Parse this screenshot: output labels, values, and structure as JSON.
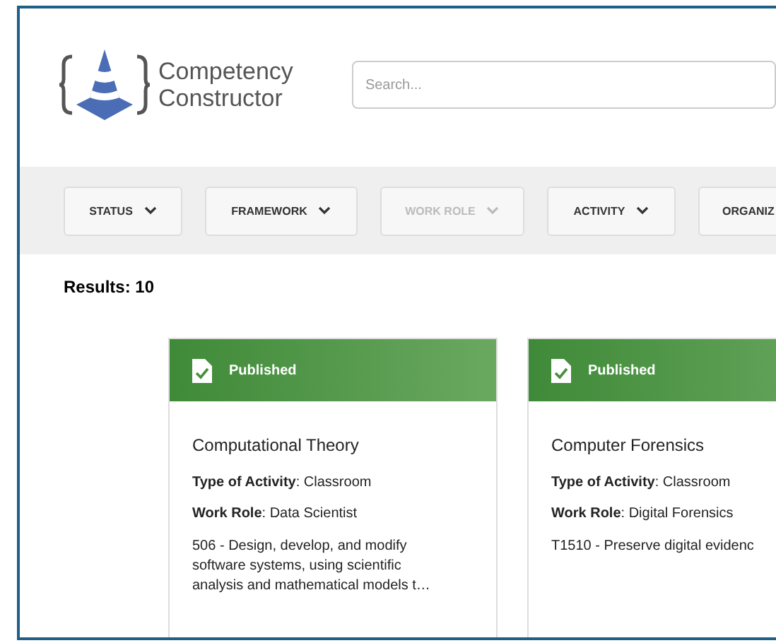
{
  "app": {
    "name_line_1": "Competency",
    "name_line_2": "Constructor"
  },
  "search": {
    "placeholder": "Search..."
  },
  "filters": [
    {
      "label": "STATUS",
      "disabled": false
    },
    {
      "label": "FRAMEWORK",
      "disabled": false
    },
    {
      "label": "WORK ROLE",
      "disabled": true
    },
    {
      "label": "ACTIVITY",
      "disabled": false
    },
    {
      "label": "ORGANIZ",
      "disabled": false
    }
  ],
  "results": "Results: 10",
  "cards": [
    {
      "status": "Published",
      "title": "Computational Theory",
      "activity": "**Type of Activity**: Classroom",
      "work_role": "**Work Role**: Data Scientist",
      "description": "506 - Design, develop, and modify software systems, using scientific analysis and mathematical models t…"
    },
    {
      "status": "Published",
      "title": "Computer Forensics",
      "activity": "**Type of Activity**: Classroom",
      "work_role": "**Work Role**: Digital Forensics",
      "description": "T1510 - Preserve digital evidenc"
    }
  ]
}
